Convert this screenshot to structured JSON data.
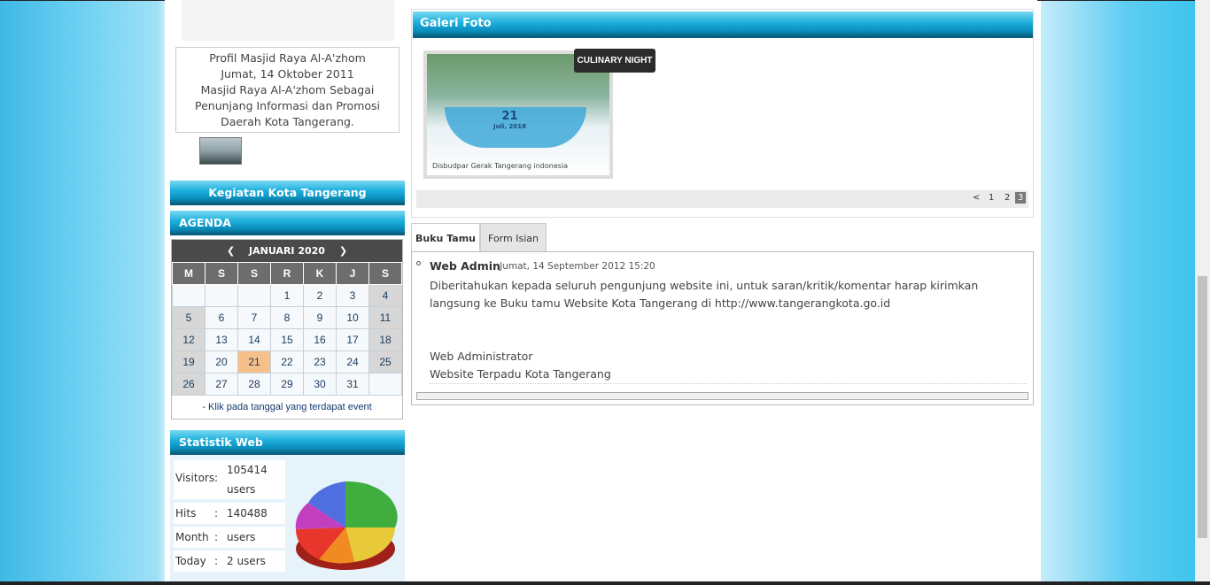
{
  "profil": {
    "title": "Profil Masjid Raya Al-A'zhom",
    "date": "Jumat, 14 Oktober 2011",
    "desc": "Masjid Raya Al-A'zhom Sebagai Penunjang Informasi dan Promosi Daerah Kota Tangerang."
  },
  "kegiatan": {
    "label": "Kegiatan Kota Tangerang"
  },
  "agenda": {
    "label": "AGENDA",
    "month": "JANUARI 2020",
    "prev": "❮",
    "next": "❯",
    "days": [
      "M",
      "S",
      "S",
      "R",
      "K",
      "J",
      "S"
    ],
    "weeks": [
      [
        "",
        "",
        "",
        "1",
        "2",
        "3",
        "4"
      ],
      [
        "5",
        "6",
        "7",
        "8",
        "9",
        "10",
        "11"
      ],
      [
        "12",
        "13",
        "14",
        "15",
        "16",
        "17",
        "18"
      ],
      [
        "19",
        "20",
        "21",
        "22",
        "23",
        "24",
        "25"
      ],
      [
        "26",
        "27",
        "28",
        "29",
        "30",
        "31",
        ""
      ]
    ],
    "today": "21",
    "note": "- Klik pada tanggal yang terdapat event"
  },
  "statistik": {
    "label": "Statistik Web",
    "rows": [
      {
        "key": "Visitors",
        "sep": ":",
        "value": "105414 users"
      },
      {
        "key": "Hits",
        "sep": ":",
        "value": "140488 hits"
      },
      {
        "key": "Month",
        "sep": ":",
        "value": "users"
      },
      {
        "key": "Today",
        "sep": ":",
        "value": "2 users"
      }
    ]
  },
  "galeri": {
    "label": "Galeri Foto",
    "tooltip": "CULINARY NIGHT",
    "photo_date": "21",
    "photo_date_sub": "Juli, 2018",
    "photo_logos": "Disbudpar   Gerak   Tangerang   indonesia",
    "pager": {
      "prev": "<",
      "pages": [
        "1",
        "2"
      ],
      "current": "3"
    }
  },
  "tabs": {
    "guestbook": "Buku Tamu",
    "form": "Form Isian"
  },
  "guestbook": {
    "name": "Web Admin",
    "date": "- Jumat, 14 September 2012 15:20",
    "message": "Diberitahukan kepada seluruh pengunjung website ini, untuk saran/kritik/komentar harap kirimkan langsung ke Buku tamu Website Kota Tangerang di http://www.tangerangkota.go.id",
    "sign1": "Web Administrator",
    "sign2": "Website Terpadu Kota Tangerang"
  },
  "colors": {
    "header_blue": "#0b8fbd",
    "today": "#f5c089",
    "weekend": "#d7d7d7"
  }
}
